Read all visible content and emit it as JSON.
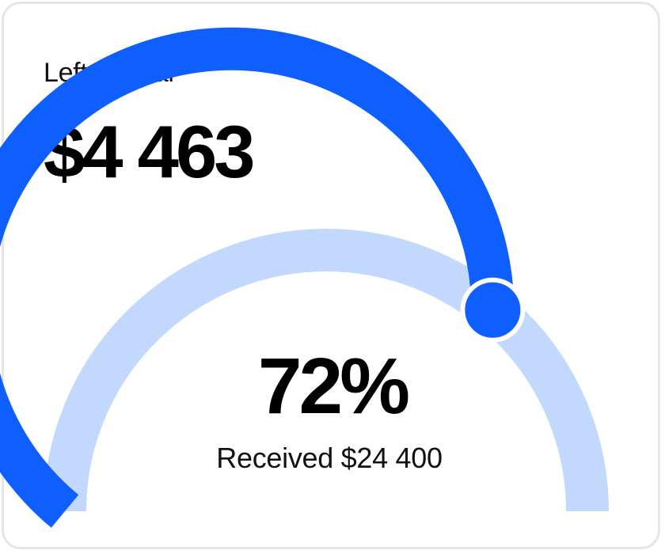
{
  "card": {
    "label": "Left to goal",
    "amount": "$4 463",
    "gauge": {
      "progress": 0.72,
      "percent_text": "72%",
      "received_text": "Received $24 400",
      "colors": {
        "filled": "#0f5efe",
        "track": "#c3d8fd",
        "knob": "#0f5efe",
        "knob_border": "#ffffff"
      }
    }
  }
}
